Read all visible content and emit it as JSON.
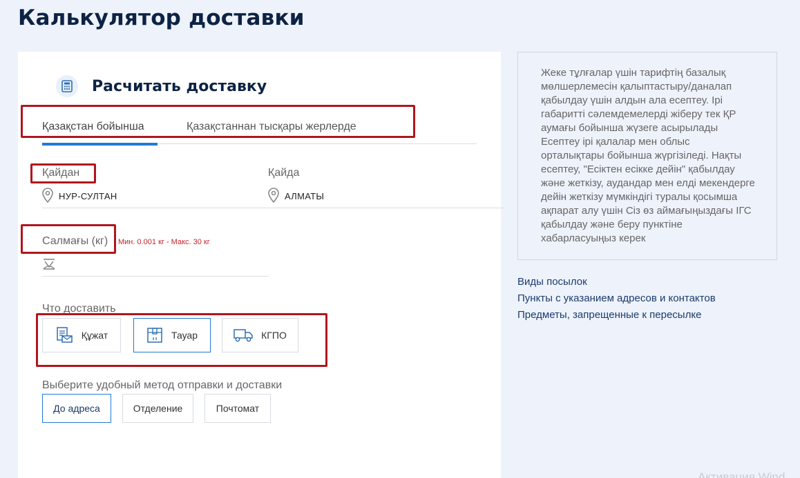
{
  "page": {
    "title": "Калькулятор доставки"
  },
  "card": {
    "title": "Расчитать доставку",
    "icon": "calculator-icon",
    "tabs": [
      {
        "label": "Қазақстан бойынша",
        "active": true
      },
      {
        "label": "Қазақстаннан тысқары жерлерде",
        "active": false
      }
    ],
    "from": {
      "label": "Қайдан",
      "value": "НУР-СУЛТАН",
      "icon": "location-pin-icon"
    },
    "to": {
      "label": "Қайда",
      "value": "АЛМАТЫ",
      "icon": "location-pin-icon"
    },
    "weight": {
      "label": "Салмағы (кг)",
      "hint": "Мин. 0.001 кг - Макс. 30 кг",
      "icon": "scale-icon",
      "value": ""
    },
    "what": {
      "label": "Что доставить",
      "options": [
        {
          "label": "Құжат",
          "icon": "document-icon",
          "active": false
        },
        {
          "label": "Тауар",
          "icon": "box-icon",
          "active": true
        },
        {
          "label": "КГПО",
          "icon": "truck-icon",
          "active": false
        }
      ]
    },
    "method": {
      "label": "Выберите удобный метод отправки и доставки",
      "options": [
        {
          "label": "До адреса",
          "active": true
        },
        {
          "label": "Отделение",
          "active": false
        },
        {
          "label": "Почтомат",
          "active": false
        }
      ]
    }
  },
  "info": {
    "text": "Жеке тұлғалар үшін тарифтің базалық мөлшерлемесін қалыптастыру/даналап қабылдау үшін алдын ала есептеу. Ірі габаритті сәлемдемелерді жіберу тек ҚР аумағы бойынша жүзеге асырылады Есептеу ірі қалалар мен облыс орталықтары бойынша жүргізіледі. Нақты есептеу, \"Есіктен есікке дейін\" қабылдау және жеткізу, аудандар мен елді мекендерге дейін жеткізу мүмкіндігі туралы қосымша ақпарат алу үшін Сіз өз аймағыңыздағы ІГС қабылдау және беру пунктіне хабарласуыңыз керек"
  },
  "links": [
    "Виды посылок",
    "Пункты с указанием адресов и контактов",
    "Предметы, запрещенные к пересылке"
  ],
  "watermark": "Активация Wind",
  "colors": {
    "accent": "#1f7ad6",
    "title": "#0d2344",
    "highlight": "#b0151d",
    "hint": "#c0252a"
  }
}
